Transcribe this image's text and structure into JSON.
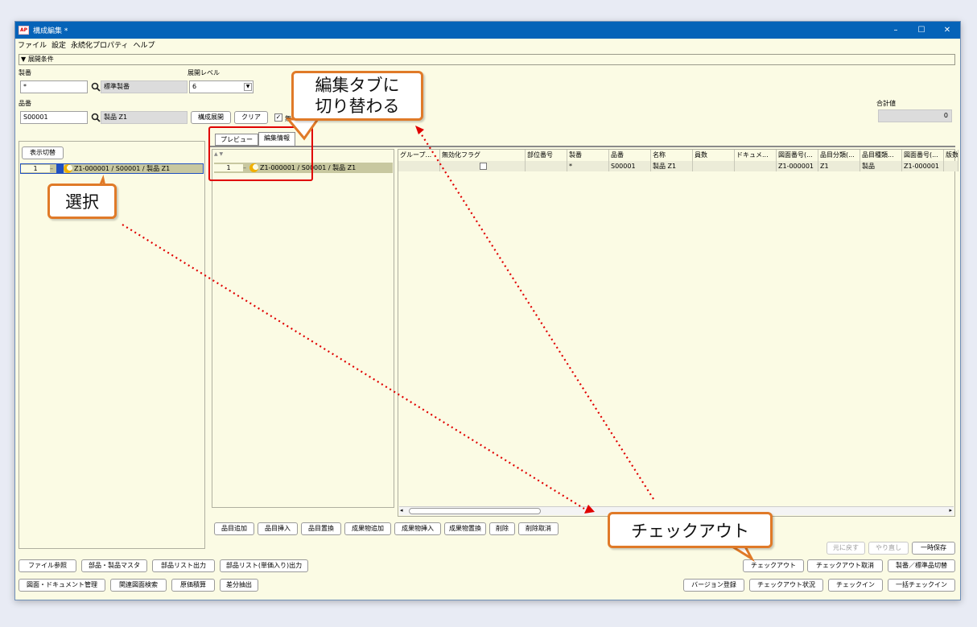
{
  "window": {
    "title": "構成編集 *",
    "app_icon_text": "AP",
    "controls": [
      "–",
      "☐",
      "✕"
    ]
  },
  "menu": [
    "ファイル",
    "設定",
    "永続化プロパティ",
    "ヘルプ"
  ],
  "conditions": {
    "header": "▼ 展開条件",
    "serial_label": "製番",
    "serial_value": "*",
    "serial_name": "標準製番",
    "level_label": "展開レベル",
    "level_value": "6",
    "item_label": "品番",
    "item_value": "S00001",
    "item_name": "製品 Z1",
    "expand_button": "構成展開",
    "clear_button": "クリア",
    "checkbox_label": "無",
    "total_label": "合計値",
    "total_value": "0"
  },
  "left_panel": {
    "toggle_button": "表示切替",
    "row_num": "1",
    "row_text": "Z1-000001 / S00001 / 製品 Z1"
  },
  "tabs": [
    "プレビュー",
    "編集情報"
  ],
  "mid_tree": {
    "row_num": "1",
    "row_text": "Z1-000001 / S00001 / 製品 Z1",
    "sort_up": "▲",
    "sort_down": "▼"
  },
  "grid": {
    "headers": [
      "グループ...",
      "無効化フラグ",
      "部位番号",
      "製番",
      "品番",
      "名称",
      "員数",
      "ドキュメ...",
      "図面番号(...",
      "品目分類(...",
      "品目種類...",
      "図面番号(...",
      "版数"
    ],
    "row": [
      "",
      "",
      "",
      "*",
      "S00001",
      "製品 Z1",
      "",
      "",
      "Z1-000001",
      "Z1",
      "製品",
      "Z1-000001",
      ""
    ]
  },
  "edit_buttons": [
    "品目追加",
    "品目挿入",
    "品目置換",
    "成果物追加",
    "成果物挿入",
    "成果物置換",
    "削除",
    "削除取消"
  ],
  "undo_buttons": [
    "元に戻す",
    "やり直し",
    "一時保存"
  ],
  "bottom_left_row1": [
    "ファイル参照",
    "部品・製品マスタ",
    "部品リスト出力",
    "部品リスト(単価入り)出力"
  ],
  "bottom_left_row2": [
    "図面・ドキュメント管理",
    "関連図面検索",
    "原価積算",
    "差分抽出"
  ],
  "bottom_right_row1": [
    "チェックアウト",
    "チェックアウト取消",
    "製番／標準品切替"
  ],
  "bottom_right_row2": [
    "バージョン登録",
    "チェックアウト状況",
    "チェックイン",
    "一括チェックイン"
  ],
  "callouts": {
    "edit_tab": "編集タブに\n切り替わる",
    "select": "選択",
    "checkout": "チェックアウト"
  },
  "colors": {
    "titlebar": "#0563b8",
    "background": "#fbfbe4",
    "callout_border": "#e07a28",
    "annotation_red": "#e00000"
  }
}
